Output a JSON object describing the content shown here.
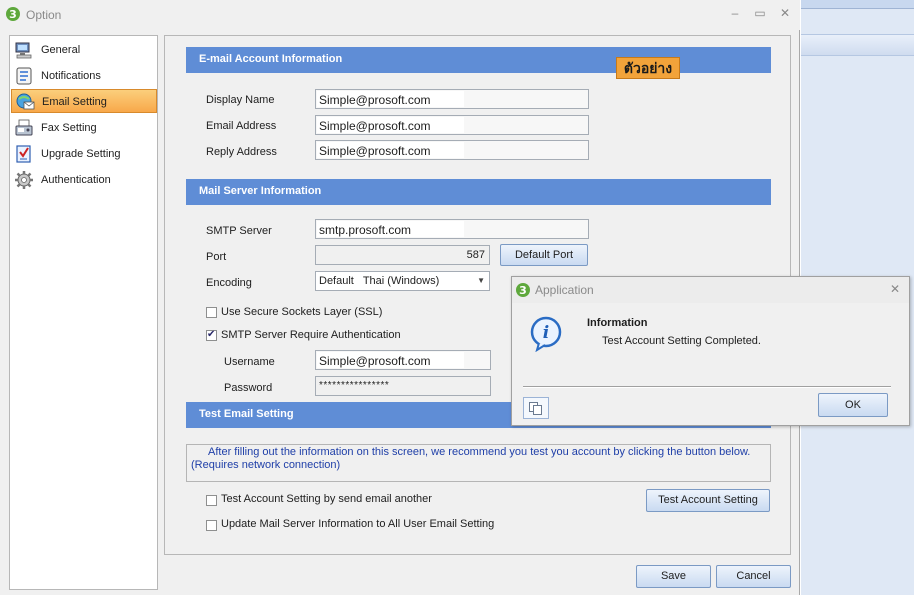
{
  "window": {
    "title": "Option",
    "minimize": "–",
    "maximize": "▭",
    "close": "✕"
  },
  "sidebar": {
    "items": [
      {
        "label": "General",
        "icon": "computer-icon",
        "active": false
      },
      {
        "label": "Notifications",
        "icon": "notification-icon",
        "active": false
      },
      {
        "label": "Email Setting",
        "icon": "email-icon",
        "active": true
      },
      {
        "label": "Fax Setting",
        "icon": "fax-icon",
        "active": false
      },
      {
        "label": "Upgrade Setting",
        "icon": "checklist-icon",
        "active": false
      },
      {
        "label": "Authentication",
        "icon": "gear-icon",
        "active": false
      }
    ]
  },
  "email_account": {
    "heading": "E-mail Account Information",
    "display_name_label": "Display Name",
    "display_name_value": "Simple@prosoft.com",
    "email_address_label": "Email Address",
    "email_address_value": "Simple@prosoft.com",
    "reply_address_label": "Reply Address",
    "reply_address_value": "Simple@prosoft.com"
  },
  "example_badge": "ตัวอย่าง",
  "mail_server": {
    "heading": "Mail Server Information",
    "smtp_label": "SMTP Server",
    "smtp_value": "smtp.prosoft.com",
    "port_label": "Port",
    "port_value": "587",
    "default_port_button": "Default Port",
    "encoding_label": "Encoding",
    "encoding_value": "Default   Thai (Windows)",
    "ssl_label": "Use Secure Sockets Layer (SSL)",
    "ssl_checked": false,
    "auth_label": "SMTP Server Require Authentication",
    "auth_checked": true,
    "username_label": "Username",
    "username_value": "Simple@prosoft.com",
    "password_label": "Password",
    "password_value": "****************"
  },
  "test_email": {
    "heading": "Test Email Setting",
    "info_line1": "After filling out the information on this screen, we recommend you test you account by clicking the button below.",
    "info_line2": "(Requires network connection)",
    "send_another_label": "Test Account Setting by send email another",
    "send_another_checked": false,
    "update_all_label": "Update Mail Server Information to All User Email Setting",
    "update_all_checked": false,
    "test_button": "Test Account Setting"
  },
  "footer": {
    "save_button": "Save",
    "cancel_button": "Cancel"
  },
  "popup": {
    "title": "Application",
    "close": "✕",
    "heading": "Information",
    "message": "Test Account Setting Completed.",
    "ok_button": "OK",
    "info_icon_glyph": "i"
  },
  "colors": {
    "section_header": "#5f8dd6",
    "active_item": "#f8a84a",
    "badge": "#f2a33a",
    "info_text": "#1f3fa8"
  }
}
